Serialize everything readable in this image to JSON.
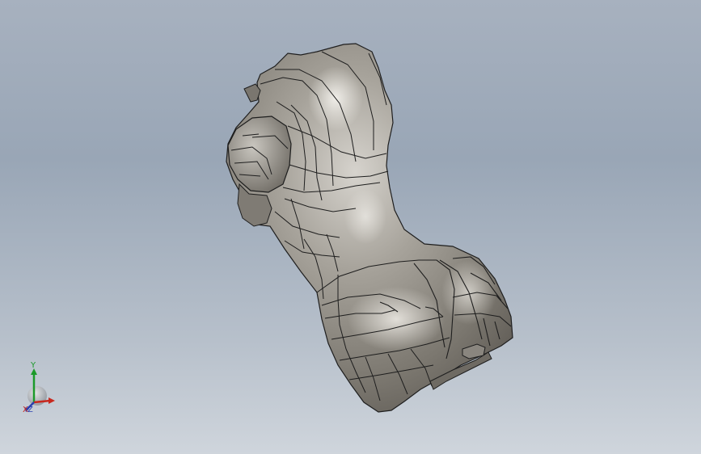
{
  "viewport": {
    "background_top": "#a7b1bf",
    "background_bottom": "#cfd5dc"
  },
  "model": {
    "surface_color": "#8f8b84",
    "highlight_color": "#d8d5cf",
    "edge_color": "#1e1e1e"
  },
  "triad": {
    "y_label": "Y",
    "x_label": "X",
    "z_label": "Z",
    "y_color": "#1c9a2a",
    "x_color": "#c8281e",
    "z_color": "#2a3fb0"
  }
}
